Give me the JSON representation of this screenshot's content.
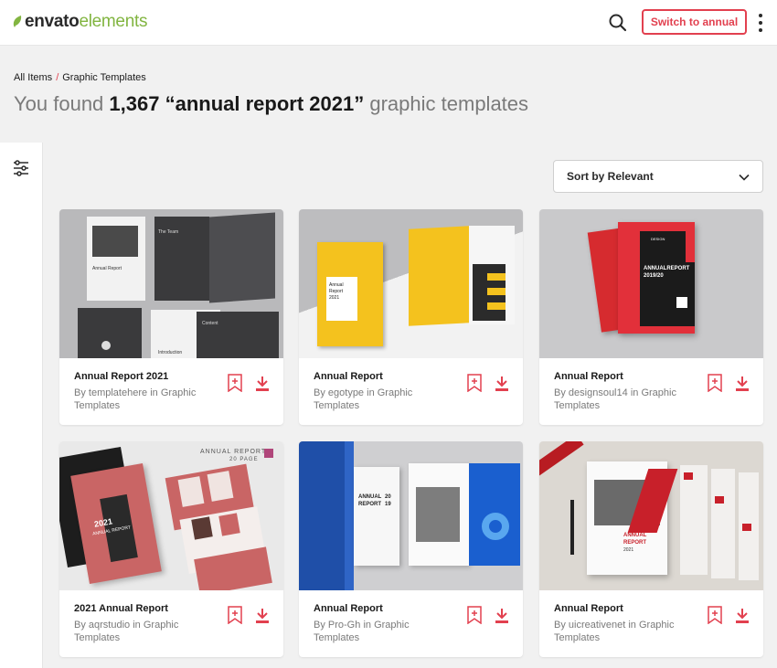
{
  "brand": {
    "logo_part1": "envato",
    "logo_part2": "elements",
    "leaf_color": "#82b541",
    "accent_color": "#e2404f"
  },
  "header": {
    "search_icon": "search-icon",
    "switch_label": "Switch to annual",
    "more_icon": "kebab-menu-icon"
  },
  "breadcrumb": {
    "root": "All Items",
    "separator": "/",
    "current": "Graphic Templates"
  },
  "results": {
    "prefix": "You found",
    "count": "1,367",
    "query": "“annual report 2021”",
    "suffix": "graphic templates"
  },
  "filter": {
    "icon": "filter-sliders-icon"
  },
  "sort": {
    "label": "Sort by Relevant",
    "icon": "chevron-down-icon"
  },
  "cards": [
    {
      "title": "Annual Report 2021",
      "author": "templatehere",
      "in_text": "in",
      "category": "Graphic Templates",
      "thumb": {
        "t1": "The Team",
        "t2": "Annual Report",
        "t3": "Content",
        "t4": "Introduction"
      }
    },
    {
      "title": "Annual Report",
      "author": "egotype",
      "in_text": "in",
      "category": "Graphic Templates",
      "thumb": {
        "t1": "Annual",
        "t2": "Report",
        "t3": "2021"
      }
    },
    {
      "title": "Annual Report",
      "author": "designsoul14",
      "in_text": "in",
      "category": "Graphic Templates",
      "thumb": {
        "t1": "ANNUALREPORT",
        "t2": "2019/20",
        "t3": "DESIGN"
      }
    },
    {
      "title": "2021 Annual Report",
      "author": "aqrstudio",
      "in_text": "in",
      "category": "Graphic Templates",
      "thumb": {
        "t1": "ANNUAL REPORT",
        "t2": "20 PAGE",
        "t3": "2021",
        "t4": "ANNUAL REPORT"
      }
    },
    {
      "title": "Annual Report",
      "author": "Pro-Gh",
      "in_text": "in",
      "category": "Graphic Templates",
      "thumb": {
        "t1": "ANNUAL",
        "t2": "REPORT",
        "t3": "20",
        "t4": "19"
      }
    },
    {
      "title": "Annual Report",
      "author": "uicreativenet",
      "in_text": "in",
      "category": "Graphic Templates",
      "thumb": {
        "t1": "ANNUAL",
        "t2": "REPORT",
        "t3": "2021"
      }
    }
  ],
  "card_actions": {
    "bookmark_icon": "bookmark-add-icon",
    "download_icon": "download-icon"
  },
  "by_prefix": "By"
}
